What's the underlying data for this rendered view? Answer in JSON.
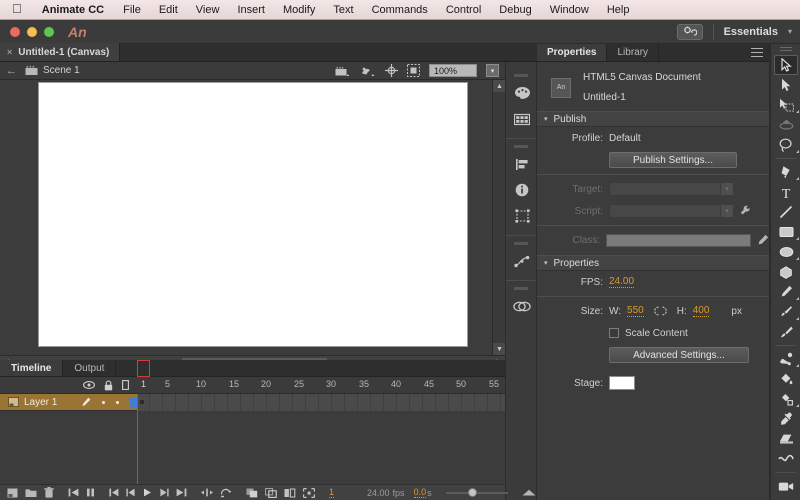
{
  "os_menu": {
    "apple_icon": "apple-logo",
    "app_name": "Animate CC",
    "items": [
      "File",
      "Edit",
      "View",
      "Insert",
      "Modify",
      "Text",
      "Commands",
      "Control",
      "Debug",
      "Window",
      "Help"
    ]
  },
  "titlebar": {
    "app_badge": "An",
    "sync_icon": "sync-settings-icon",
    "workspace": "Essentials",
    "workspace_caret": "▾"
  },
  "document_tab": {
    "close_icon": "×",
    "label": "Untitled-1 (Canvas)"
  },
  "edit_bar": {
    "back_icon": "←",
    "scene_icon": "scene-icon",
    "scene_label": "Scene 1",
    "edit_scene_icon": "edit-scene-icon",
    "edit_symbol_icon": "edit-symbol-icon",
    "center_icon": "center-stage-icon",
    "clip_icon": "clip-content-icon",
    "zoom_value": "100%",
    "zoom_caret": "▾"
  },
  "dock": {
    "items": [
      {
        "name": "color-panel-icon"
      },
      {
        "name": "swatches-panel-icon"
      },
      {
        "name": "align-panel-icon"
      },
      {
        "name": "info-panel-icon"
      },
      {
        "name": "transform-panel-icon"
      },
      {
        "name": "motion-editor-icon"
      },
      {
        "name": "code-snippets-icon"
      }
    ]
  },
  "properties_panel": {
    "tabs": [
      {
        "label": "Properties",
        "active": true
      },
      {
        "label": "Library",
        "active": false
      }
    ],
    "menu_icon": "panel-menu-icon",
    "doc_icon": "document-type-icon",
    "doc_type": "HTML5 Canvas Document",
    "doc_name": "Untitled-1",
    "publish": {
      "title": "Publish",
      "triangle": "▾",
      "profile_label": "Profile:",
      "profile_value": "Default",
      "publish_settings_button": "Publish Settings...",
      "target_label": "Target:",
      "target_value": "",
      "script_label": "Script:",
      "script_value": "",
      "script_tool_icon": "wrench-icon",
      "class_label": "Class:",
      "class_value": "",
      "class_edit_icon": "pencil-icon",
      "dropdown_caret": "▾"
    },
    "properties": {
      "title": "Properties",
      "triangle": "▾",
      "fps_label": "FPS:",
      "fps_value": "24.00",
      "size_label": "Size:",
      "width_label": "W:",
      "width_value": "550",
      "link_icon": "link-dimensions-icon",
      "height_label": "H:",
      "height_value": "400",
      "units": "px",
      "scale_content_label": "Scale Content",
      "scale_content_checked": false,
      "advanced_settings_button": "Advanced Settings...",
      "stage_label": "Stage:",
      "stage_color": "#ffffff"
    }
  },
  "tools_panel": {
    "grip_icon": "panel-grip-icon",
    "tools": [
      {
        "name": "selection-tool",
        "active": true,
        "dim": false,
        "corner": false
      },
      {
        "name": "subselection-tool",
        "active": false,
        "dim": false,
        "corner": false
      },
      {
        "name": "free-transform-tool",
        "active": false,
        "dim": false,
        "corner": true
      },
      {
        "name": "3d-rotation-tool",
        "active": false,
        "dim": true,
        "corner": false
      },
      {
        "name": "lasso-tool",
        "active": false,
        "dim": false,
        "corner": true
      },
      {
        "name": "pen-tool",
        "active": false,
        "dim": false,
        "corner": true
      },
      {
        "name": "text-tool",
        "active": false,
        "dim": false,
        "corner": false
      },
      {
        "name": "line-tool",
        "active": false,
        "dim": false,
        "corner": false
      },
      {
        "name": "rectangle-tool",
        "active": false,
        "dim": false,
        "corner": true
      },
      {
        "name": "oval-tool",
        "active": false,
        "dim": false,
        "corner": true
      },
      {
        "name": "polygon-tool",
        "active": false,
        "dim": false,
        "corner": false
      },
      {
        "name": "pencil-tool",
        "active": false,
        "dim": false,
        "corner": true
      },
      {
        "name": "brush-tool",
        "active": false,
        "dim": false,
        "corner": true
      },
      {
        "name": "paint-brush-tool",
        "active": false,
        "dim": false,
        "corner": false
      },
      {
        "name": "bone-tool",
        "active": false,
        "dim": false,
        "corner": true
      },
      {
        "name": "paint-bucket-tool",
        "active": false,
        "dim": false,
        "corner": false
      },
      {
        "name": "ink-bottle-tool",
        "active": false,
        "dim": false,
        "corner": true
      },
      {
        "name": "eyedropper-tool",
        "active": false,
        "dim": false,
        "corner": false
      },
      {
        "name": "eraser-tool",
        "active": false,
        "dim": false,
        "corner": false
      },
      {
        "name": "width-tool",
        "active": false,
        "dim": false,
        "corner": false
      },
      {
        "name": "camera-tool",
        "active": false,
        "dim": false,
        "corner": false
      }
    ]
  },
  "timeline": {
    "tabs": [
      {
        "label": "Timeline",
        "active": true
      },
      {
        "label": "Output",
        "active": false
      }
    ],
    "header_icons": [
      "eye-icon",
      "lock-icon",
      "outline-icon"
    ],
    "ruler_ticks": [
      "1",
      "5",
      "10",
      "15",
      "20",
      "25",
      "30",
      "35",
      "40",
      "45",
      "50",
      "55"
    ],
    "layers": [
      {
        "name": "Layer 1",
        "icon": "layer-icon",
        "pencil_icon": "pencil-icon",
        "visible_dot": "•",
        "lock_dot": "•",
        "outline_color": "#3d7fd6",
        "selected": true
      }
    ],
    "footer": {
      "new_layer_icon": "new-layer-icon",
      "new_folder_icon": "new-folder-icon",
      "delete_icon": "trash-icon",
      "goto_start_icon": "go-to-start-icon",
      "pause_icon": "pause-icon",
      "prev_keyframe_icon": "previous-keyframe-icon",
      "step_back_icon": "step-back-icon",
      "play_icon": "play-icon",
      "step_forward_icon": "step-forward-icon",
      "goto_end_icon": "go-to-end-icon",
      "center_frame_icon": "center-frame-icon",
      "loop_icon": "loop-icon",
      "onion_skin_icon": "onion-skin-icon",
      "onion_outline_icon": "onion-skin-outline-icon",
      "edit_multiple_icon": "edit-multiple-frames-icon",
      "modify_markers_icon": "modify-onion-markers-icon",
      "current_frame": "1",
      "fps": "24.00",
      "fps_unit": "fps",
      "elapsed": "0.0",
      "elapsed_unit": "s",
      "resize_icon": "resize-grip-icon"
    }
  },
  "colors": {
    "panel_bg": "#3c3c3c",
    "accent_number": "#d99b28",
    "layer_selected": "#9a7434",
    "playhead": "#d43b3b",
    "stage": "#ffffff"
  }
}
